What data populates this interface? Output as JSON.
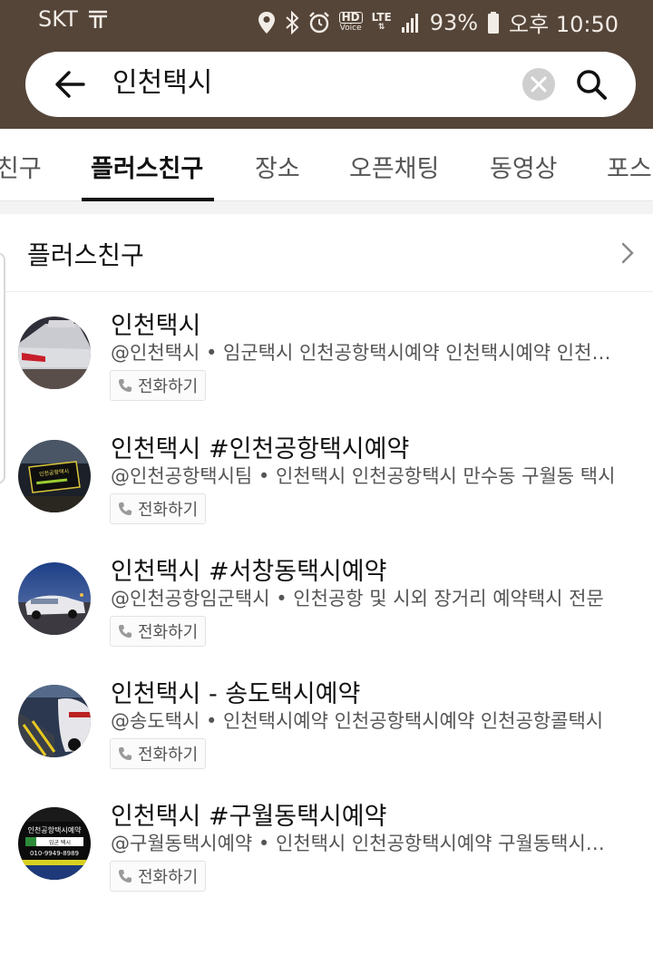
{
  "status_bar": {
    "carrier": "SKT",
    "hd_label": "HD",
    "voice_label": "Voice",
    "lte_label": "LTE",
    "battery": "93%",
    "time": "오후 10:50"
  },
  "search": {
    "query": "인천택시"
  },
  "tabs": [
    {
      "label": "친구",
      "active": false
    },
    {
      "label": "플러스친구",
      "active": true
    },
    {
      "label": "장소",
      "active": false
    },
    {
      "label": "오픈채팅",
      "active": false
    },
    {
      "label": "동영상",
      "active": false
    },
    {
      "label": "포스",
      "active": false
    }
  ],
  "section": {
    "title": "플러스친구"
  },
  "results": [
    {
      "title": "인천택시",
      "desc": "@인천택시 • 임군택시 인천공항택시예약 인천택시예약 인천공항콜택시",
      "call_label": "전화하기"
    },
    {
      "title": "인천택시 #인천공항택시예약",
      "desc": "@인천공항택시팀 • 인천택시 인천공항택시 만수동 구월동 택시",
      "call_label": "전화하기"
    },
    {
      "title": "인천택시 #서창동택시예약",
      "desc": "@인천공항임군택시 • 인천공항 및 시외 장거리 예약택시 전문",
      "call_label": "전화하기"
    },
    {
      "title": "인천택시 - 송도택시예약",
      "desc": "@송도택시 • 인천택시예약 인천공항택시예약 인천공항콜택시",
      "call_label": "전화하기"
    },
    {
      "title": "인천택시 #구월동택시예약",
      "desc": "@구월동택시예약 • 인천택시 인천공항택시예약 구월동택시예약",
      "call_label": "전화하기"
    }
  ],
  "avatar_texts": {
    "sign_2": "인천공항택시",
    "sign_5_top": "인천공항택시예약",
    "sign_5_mid": "임군 택시",
    "sign_5_phone": "010-9949-8989"
  },
  "colors": {
    "header_bg": "#554539",
    "active_tab": "#111111"
  }
}
